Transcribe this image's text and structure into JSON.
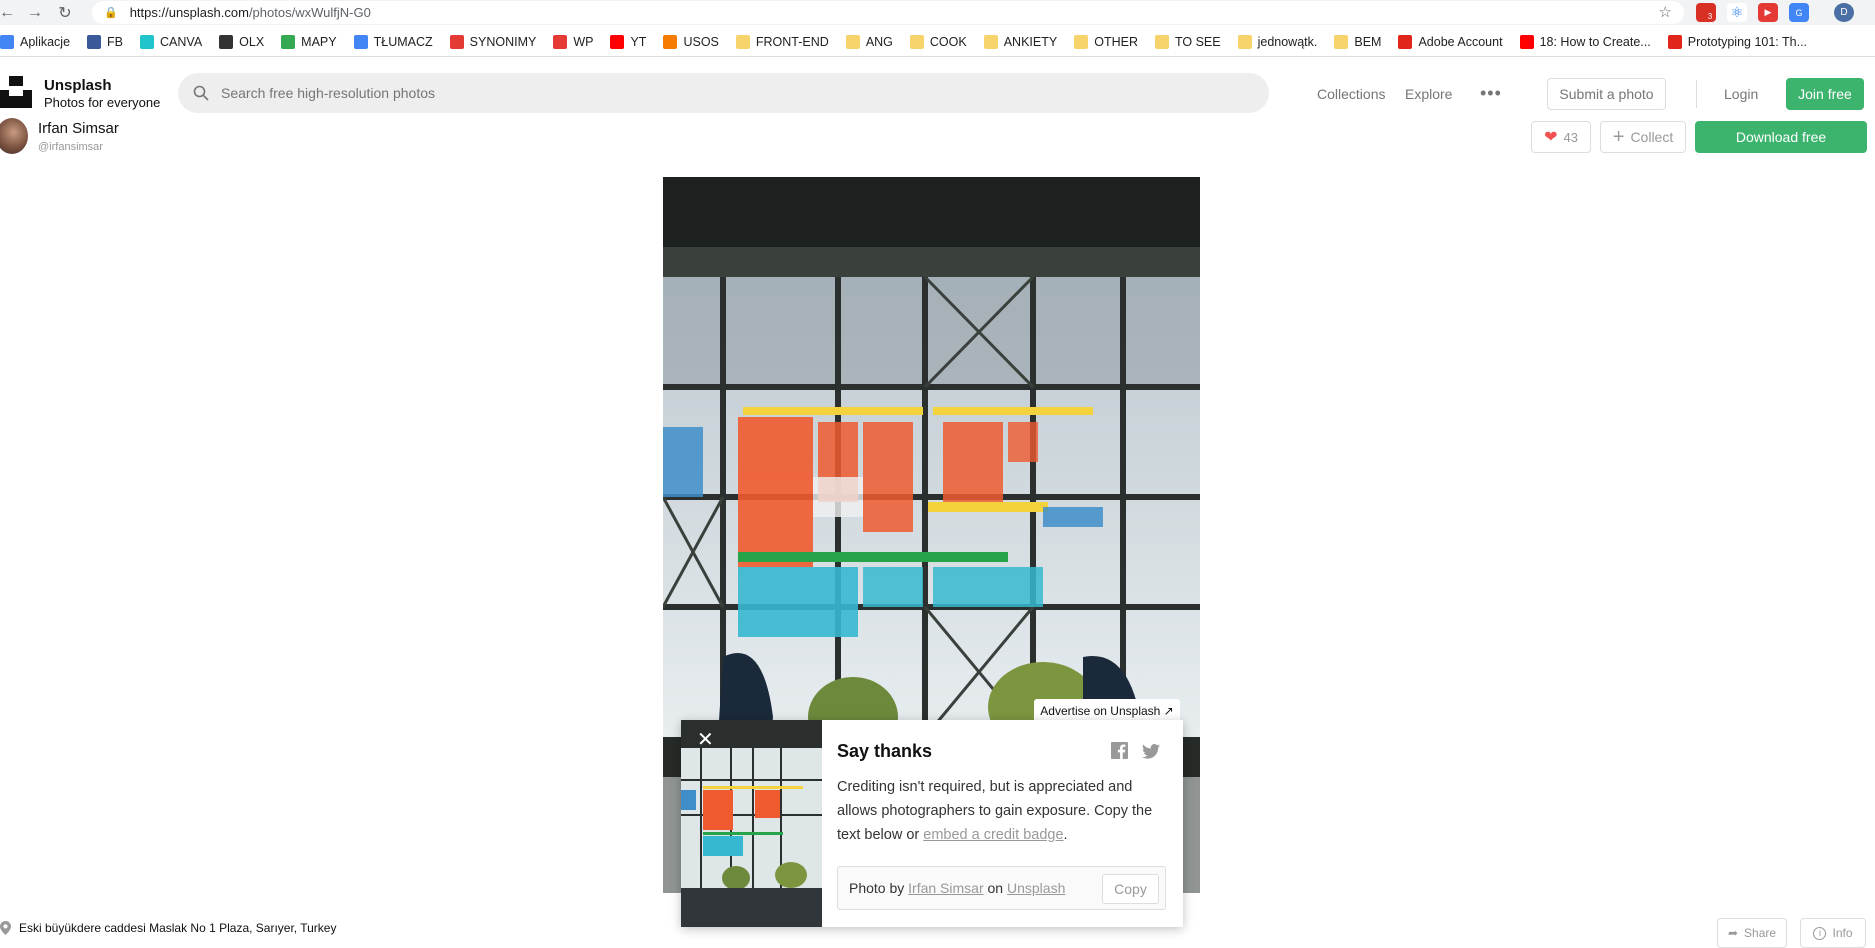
{
  "browser": {
    "url_host": "https://unsplash.com",
    "url_path": "/photos/wxWulfjN-G0",
    "bookmarks": [
      {
        "label": "Aplikacje",
        "icon": "apps-grid-icon",
        "color": "#4285f4"
      },
      {
        "label": "FB",
        "icon": "facebook-icon",
        "color": "#3b5998"
      },
      {
        "label": "CANVA",
        "icon": "canva-icon",
        "color": "#20c4cb"
      },
      {
        "label": "OLX",
        "icon": "olx-icon",
        "color": "#333333"
      },
      {
        "label": "MAPY",
        "icon": "maps-icon",
        "color": "#34a853"
      },
      {
        "label": "TŁUMACZ",
        "icon": "translate-icon",
        "color": "#4285f4"
      },
      {
        "label": "SYNONIMY",
        "icon": "s-icon",
        "color": "#e53935"
      },
      {
        "label": "WP",
        "icon": "wp-icon",
        "color": "#e53935"
      },
      {
        "label": "YT",
        "icon": "youtube-icon",
        "color": "#ff0000"
      },
      {
        "label": "USOS",
        "icon": "u-icon",
        "color": "#f57c00"
      },
      {
        "label": "FRONT-END",
        "icon": "folder-icon",
        "color": "#f6d36b"
      },
      {
        "label": "ANG",
        "icon": "folder-icon",
        "color": "#f6d36b"
      },
      {
        "label": "COOK",
        "icon": "folder-icon",
        "color": "#f6d36b"
      },
      {
        "label": "ANKIETY",
        "icon": "folder-icon",
        "color": "#f6d36b"
      },
      {
        "label": "OTHER",
        "icon": "folder-icon",
        "color": "#f6d36b"
      },
      {
        "label": "TO SEE",
        "icon": "folder-icon",
        "color": "#f6d36b"
      },
      {
        "label": "jednowątk.",
        "icon": "folder-icon",
        "color": "#f6d36b"
      },
      {
        "label": "BEM",
        "icon": "folder-icon",
        "color": "#f6d36b"
      },
      {
        "label": "Adobe Account",
        "icon": "adobe-icon",
        "color": "#e1251b"
      },
      {
        "label": "18: How to Create...",
        "icon": "youtube-icon",
        "color": "#ff0000"
      },
      {
        "label": "Prototyping 101: Th...",
        "icon": "adobe-icon",
        "color": "#e1251b"
      }
    ],
    "profile_initial": "D",
    "ext_badge": "3"
  },
  "header": {
    "brand": "Unsplash",
    "tagline": "Photos for everyone",
    "search_placeholder": "Search free high-resolution photos",
    "nav": [
      "Collections",
      "Explore"
    ],
    "submit_label": "Submit a photo",
    "login_label": "Login",
    "join_label": "Join free"
  },
  "photo": {
    "author_name": "Irfan Simsar",
    "author_handle": "@irfansimsar",
    "likes": "43",
    "collect_label": "Collect",
    "download_label": "Download free",
    "location": "Eski büyükdere caddesi Maslak No 1 Plaza, Sarıyer, Turkey"
  },
  "popup": {
    "advertise": "Advertise on Unsplash ↗",
    "title": "Say thanks",
    "text_before": "Crediting isn't required, but is appreciated and allows photographers to gain exposure. Copy the text below or ",
    "link": "embed a credit badge",
    "text_after": ".",
    "credit_prefix": "Photo by ",
    "credit_author": "Irfan Simsar",
    "credit_mid": " on ",
    "credit_site": "Unsplash",
    "copy_label": "Copy"
  },
  "footer": {
    "share_label": "Share",
    "info_label": "Info"
  },
  "colors": {
    "accent_green": "#3cb46e",
    "heart": "#f15151"
  }
}
